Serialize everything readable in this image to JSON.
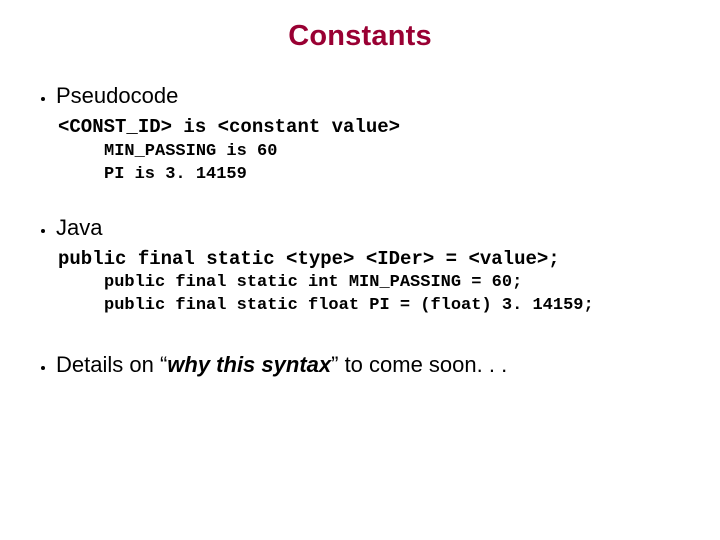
{
  "title": "Constants",
  "bullets": {
    "pseudocode": {
      "label": "Pseudocode",
      "template": "<CONST_ID> is <constant value>",
      "ex1": "MIN_PASSING is 60",
      "ex2": "PI is 3. 14159"
    },
    "java": {
      "label": "Java",
      "template": "public final static <type> <IDer> = <value>;",
      "ex1": "public final static int MIN_PASSING = 60;",
      "ex2": "public final static float PI = (float) 3. 14159;"
    },
    "details": {
      "prefix": "Details on ",
      "open_quote": "“",
      "why": "why this syntax",
      "close_quote": "”",
      "suffix": " to come soon. . ."
    }
  }
}
